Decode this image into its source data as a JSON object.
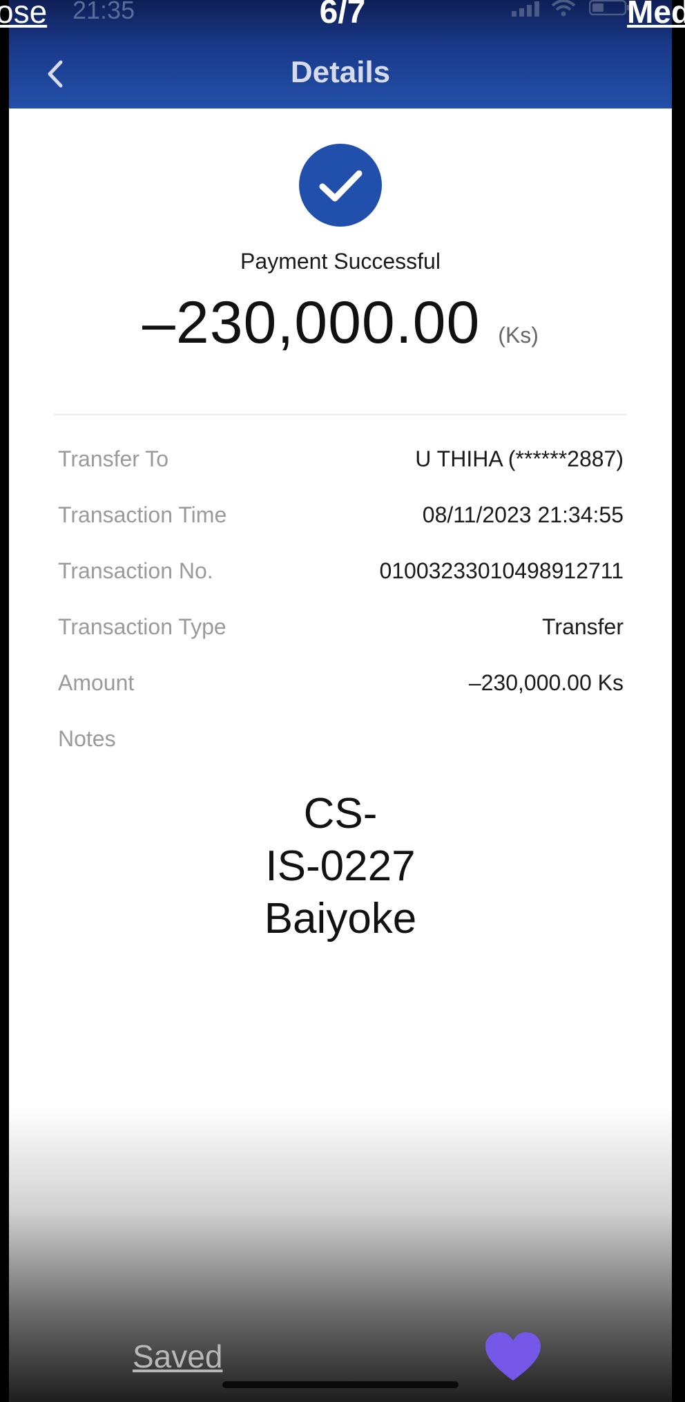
{
  "viewer": {
    "close_label": "ose",
    "page_counter": "6/7",
    "media_label": "Med",
    "saved_label": "Saved",
    "heart_icon": "heart-icon",
    "heart_color": "#7558e8"
  },
  "status_bar": {
    "time": "21:35",
    "icons": [
      "signal-icon",
      "wifi-icon",
      "battery-icon"
    ]
  },
  "header": {
    "title": "Details",
    "back_icon": "chevron-left-icon",
    "color": "#1a3a8c"
  },
  "payment": {
    "status_icon": "check-circle-icon",
    "status_text": "Payment Successful",
    "amount": "–230,000.00",
    "currency": "(Ks)",
    "accent_color": "#2050ac"
  },
  "details": [
    {
      "label": "Transfer To",
      "value": "U THIHA (******2887)"
    },
    {
      "label": "Transaction Time",
      "value": "08/11/2023 21:34:55"
    },
    {
      "label": "Transaction No.",
      "value": "01003233010498912711"
    },
    {
      "label": "Transaction Type",
      "value": "Transfer"
    },
    {
      "label": "Amount",
      "value": "–230,000.00 Ks"
    },
    {
      "label": "Notes",
      "value": ""
    }
  ],
  "notes_text": {
    "line1": "CS-",
    "line2": "IS-0227",
    "line3": "Baiyoke"
  }
}
